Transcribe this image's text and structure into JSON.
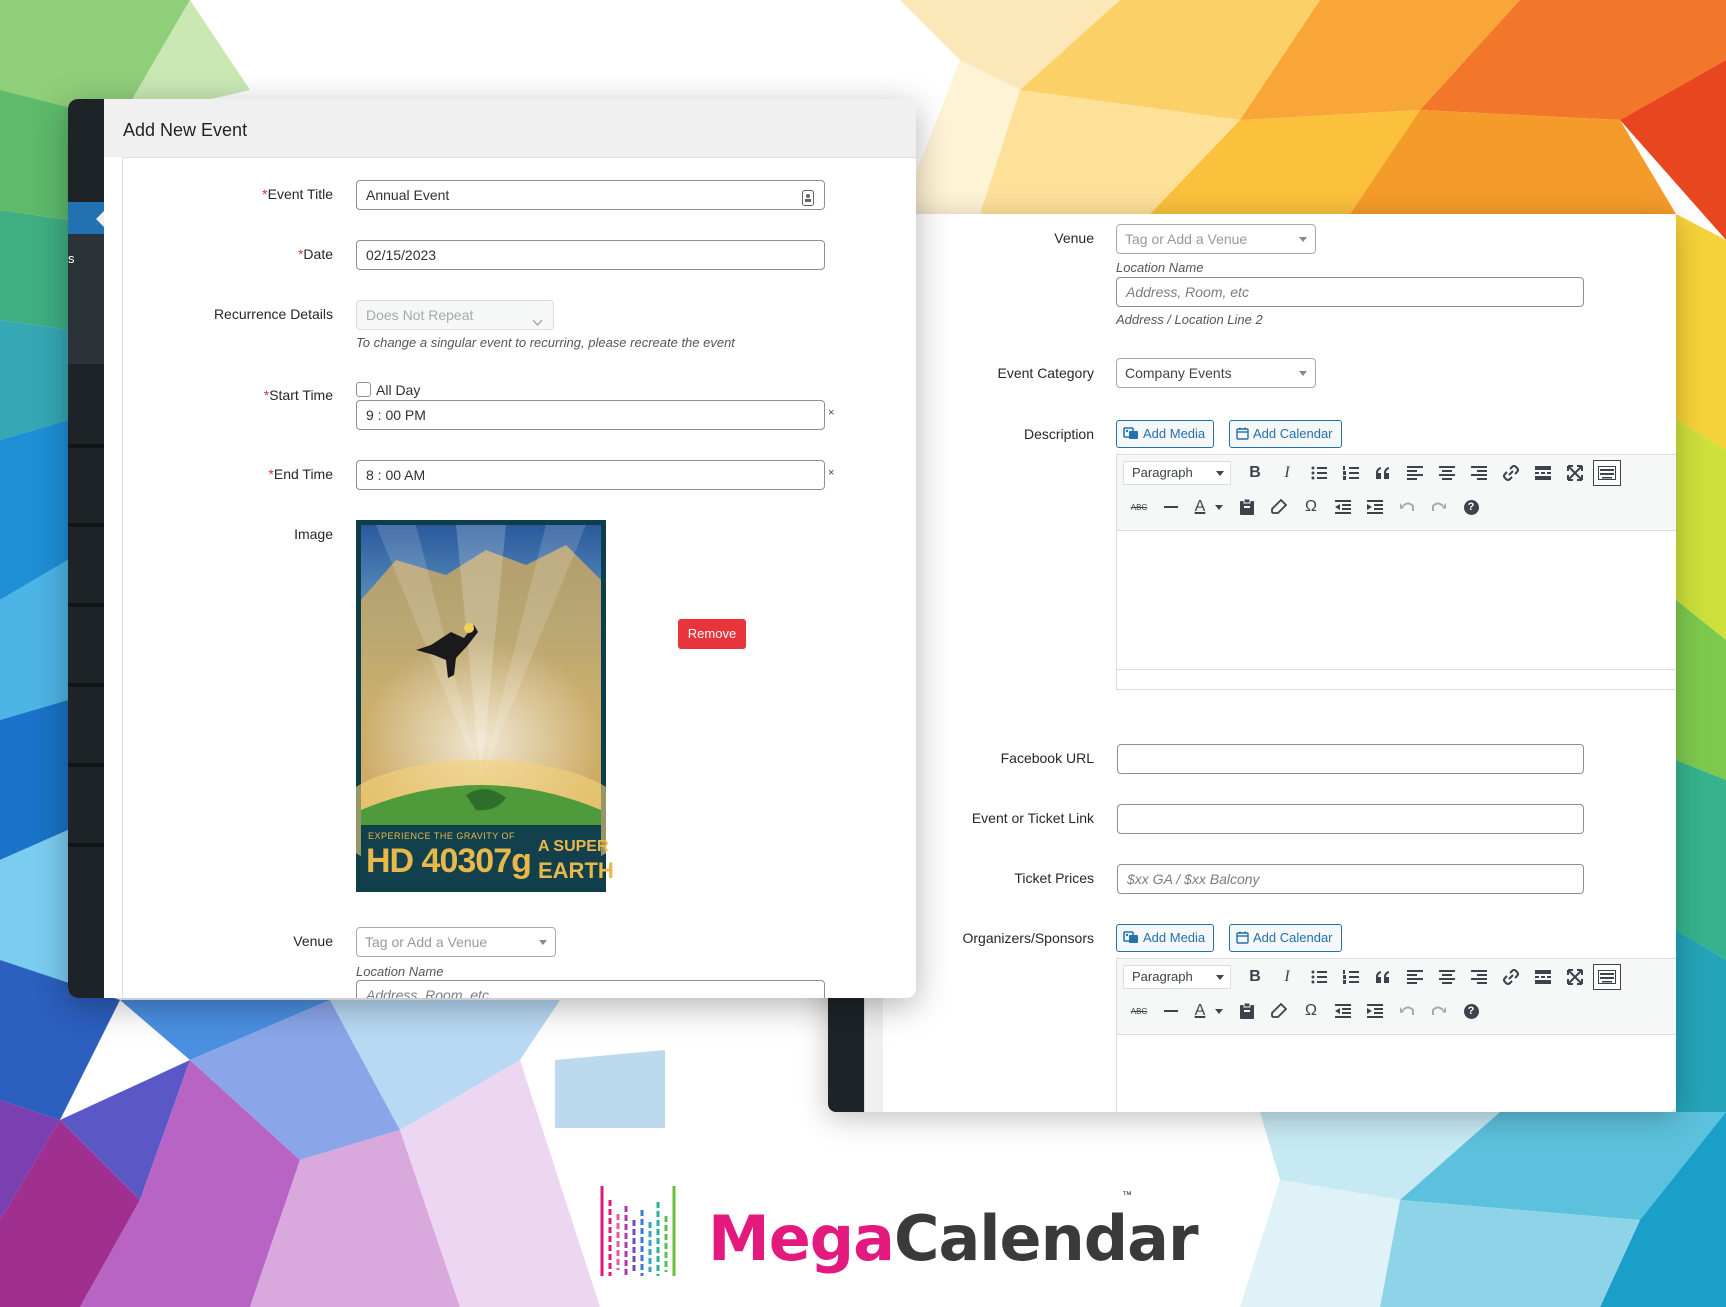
{
  "left_panel": {
    "header_title": "Add New Event",
    "admin_letter": "s",
    "event_title": {
      "label": "Event Title",
      "required_mark": "*",
      "value": "Annual Event"
    },
    "date": {
      "label": "Date",
      "required_mark": "*",
      "value": "02/15/2023"
    },
    "recurrence": {
      "label": "Recurrence Details",
      "value": "Does Not Repeat",
      "hint": "To change a singular event to recurring, please recreate the event"
    },
    "start_time": {
      "label": "Start Time",
      "required_mark": "*",
      "all_day_label": "All Day",
      "all_day_checked": false,
      "value": "9 : 00 PM",
      "clear": "×"
    },
    "end_time": {
      "label": "End Time",
      "required_mark": "*",
      "value": "8 : 00 AM",
      "clear": "×"
    },
    "image": {
      "label": "Image",
      "remove_label": "Remove",
      "poster_line1": "EXPERIENCE THE GRAVITY OF",
      "poster_big": "HD 40307g",
      "poster_right1": "A SUPER",
      "poster_right2": "EARTH"
    },
    "venue": {
      "label": "Venue",
      "placeholder": "Tag or Add a Venue",
      "location_name_label": "Location Name",
      "address_placeholder": "Address, Room, etc"
    }
  },
  "right_panel": {
    "venue": {
      "label": "Venue",
      "placeholder": "Tag or Add a Venue",
      "location_name_label": "Location Name",
      "address_placeholder": "Address, Room, etc",
      "address_line2_label": "Address / Location Line 2"
    },
    "event_category": {
      "label": "Event Category",
      "value": "Company Events"
    },
    "description": {
      "label": "Description",
      "add_media": "Add Media",
      "add_calendar": "Add Calendar",
      "format": "Paragraph"
    },
    "facebook_url": {
      "label": "Facebook URL",
      "value": ""
    },
    "ticket_link": {
      "label": "Event or Ticket Link",
      "value": ""
    },
    "ticket_prices": {
      "label": "Ticket Prices",
      "placeholder": "$xx GA / $xx Balcony"
    },
    "organizers": {
      "label": "Organizers/Sponsors",
      "add_media": "Add Media",
      "add_calendar": "Add Calendar",
      "format": "Paragraph"
    }
  },
  "toolbar_icons": {
    "row1": [
      "bold-icon",
      "italic-icon",
      "bullet-list-icon",
      "numbered-list-icon",
      "blockquote-icon",
      "align-left-icon",
      "align-center-icon",
      "align-right-icon",
      "link-icon",
      "read-more-icon",
      "fullscreen-icon",
      "toolbar-toggle-icon"
    ],
    "row2": [
      "strikethrough-icon",
      "horizontal-line-icon",
      "text-color-icon",
      "paste-text-icon",
      "clear-formatting-icon",
      "special-character-icon",
      "outdent-icon",
      "indent-icon",
      "undo-icon",
      "redo-icon",
      "help-icon"
    ],
    "glyphs": {
      "bold": "B",
      "italic": "I",
      "omega": "Ω",
      "abc": "ABC",
      "text_color": "A",
      "help": "?"
    }
  },
  "logo": {
    "mega": "Mega",
    "calendar": "Calendar",
    "tm": "™"
  },
  "colors": {
    "accent": "#2271b1",
    "remove": "#e8353b",
    "brand_pink": "#e3197e",
    "brand_dark": "#3a3a3a"
  }
}
